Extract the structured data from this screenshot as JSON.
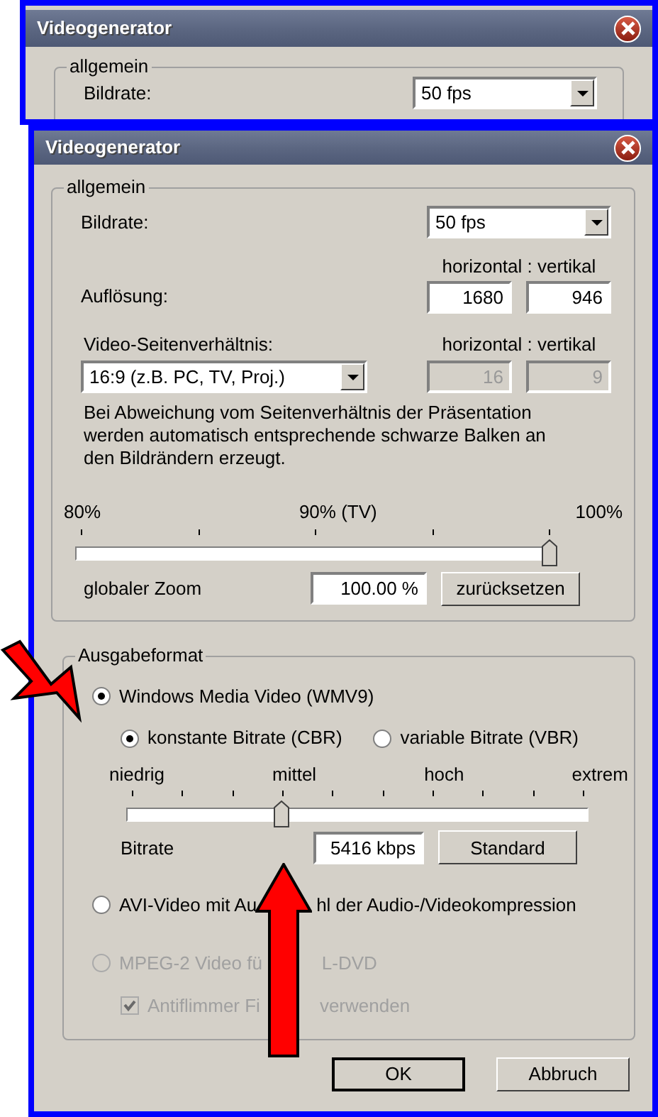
{
  "back_window": {
    "title": "Videogenerator",
    "group": "allgemein",
    "label": "Bildrate:",
    "value": "50 fps"
  },
  "window": {
    "title": "Videogenerator"
  },
  "general": {
    "title": "allgemein",
    "framerate": {
      "label": "Bildrate:",
      "value": "50 fps"
    },
    "resolution": {
      "header": "horizontal : vertikal",
      "label": "Auflösung:",
      "horizontal": "1680",
      "vertical": "946",
      "disabled": false
    },
    "aspect": {
      "label": "Video-Seitenverhältnis:",
      "value": "16:9 (z.B. PC, TV, Proj.)",
      "header": "horizontal : vertikal",
      "horizontal": "16",
      "vertical": "9",
      "disabled": true
    },
    "note": "Bei Abweichung vom Seitenverhältnis der Präsentation werden automatisch entsprechende schwarze Balken an den Bildrändern erzeugt.",
    "zoom": {
      "ticks": [
        "80%",
        "90% (TV)",
        "100%"
      ],
      "level": 1,
      "label": "globaler Zoom",
      "value": "100.00 %",
      "button": "zurücksetzen"
    }
  },
  "output": {
    "title": "Ausgabeformat",
    "wmv": {
      "label": "Windows Media Video (WMV9)",
      "selected": true,
      "disabled": false
    },
    "modes": [
      {
        "label": "konstante Bitrate (CBR)",
        "selected": true
      },
      {
        "label": "variable Bitrate (VBR)",
        "selected": false
      }
    ],
    "bitrate": {
      "ticks": [
        "niedrig",
        "mittel",
        "hoch",
        "extrem"
      ],
      "level": 0.333,
      "label": "Bitrate",
      "value": "5416 kbps",
      "button": "Standard"
    },
    "avi": {
      "label_parts": [
        "AVI-Video mit Au",
        "hl der Audio-/Videokompression"
      ],
      "selected": false,
      "disabled": false
    },
    "mpeg": {
      "label_parts": [
        "MPEG-2 Video fü",
        "L-DVD"
      ],
      "selected": false,
      "disabled": true
    },
    "antiflicker": {
      "label_parts": [
        "Antiflimmer Fi",
        "verwenden"
      ],
      "checked": true,
      "disabled": true
    }
  },
  "buttons": [
    {
      "label": "OK",
      "default": true
    },
    {
      "label": "Abbruch",
      "default": false
    }
  ]
}
